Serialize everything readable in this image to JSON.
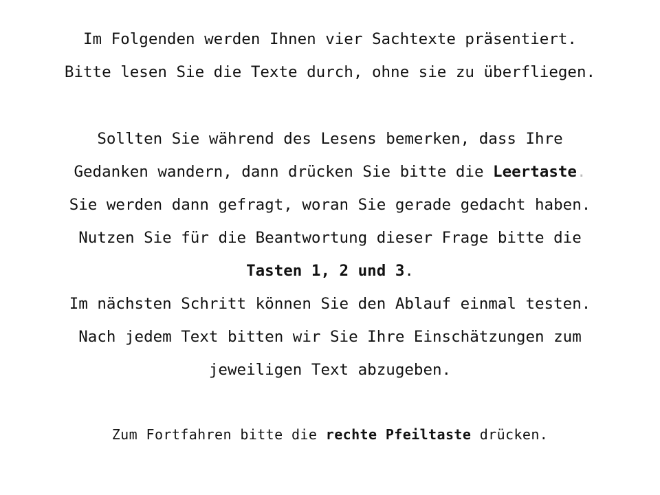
{
  "intro": {
    "line1": "Im Folgenden werden Ihnen vier Sachtexte präsentiert.",
    "line2": "Bitte lesen Sie die Texte durch, ohne sie zu überfliegen."
  },
  "instructions": {
    "line3": "Sollten Sie während des Lesens bemerken, dass Ihre",
    "line4_prefix": "Gedanken wandern, dann drücken Sie bitte die ",
    "line4_key": "Leertaste",
    "line4_period": ".",
    "line5": "Sie werden dann gefragt, woran Sie gerade gedacht haben.",
    "line6": "Nutzen Sie für die Beantwortung dieser Frage bitte die",
    "line7_keys": "Tasten 1, 2 und 3",
    "line7_period": ".",
    "line8": "Im nächsten Schritt können Sie den Ablauf einmal testen.",
    "line9": "Nach jedem Text bitten wir Sie Ihre Einschätzungen zum",
    "line10": "jeweiligen Text abzugeben."
  },
  "footer": {
    "prefix": "Zum Fortfahren bitte die ",
    "key": "rechte Pfeiltaste",
    "suffix": " drücken."
  }
}
